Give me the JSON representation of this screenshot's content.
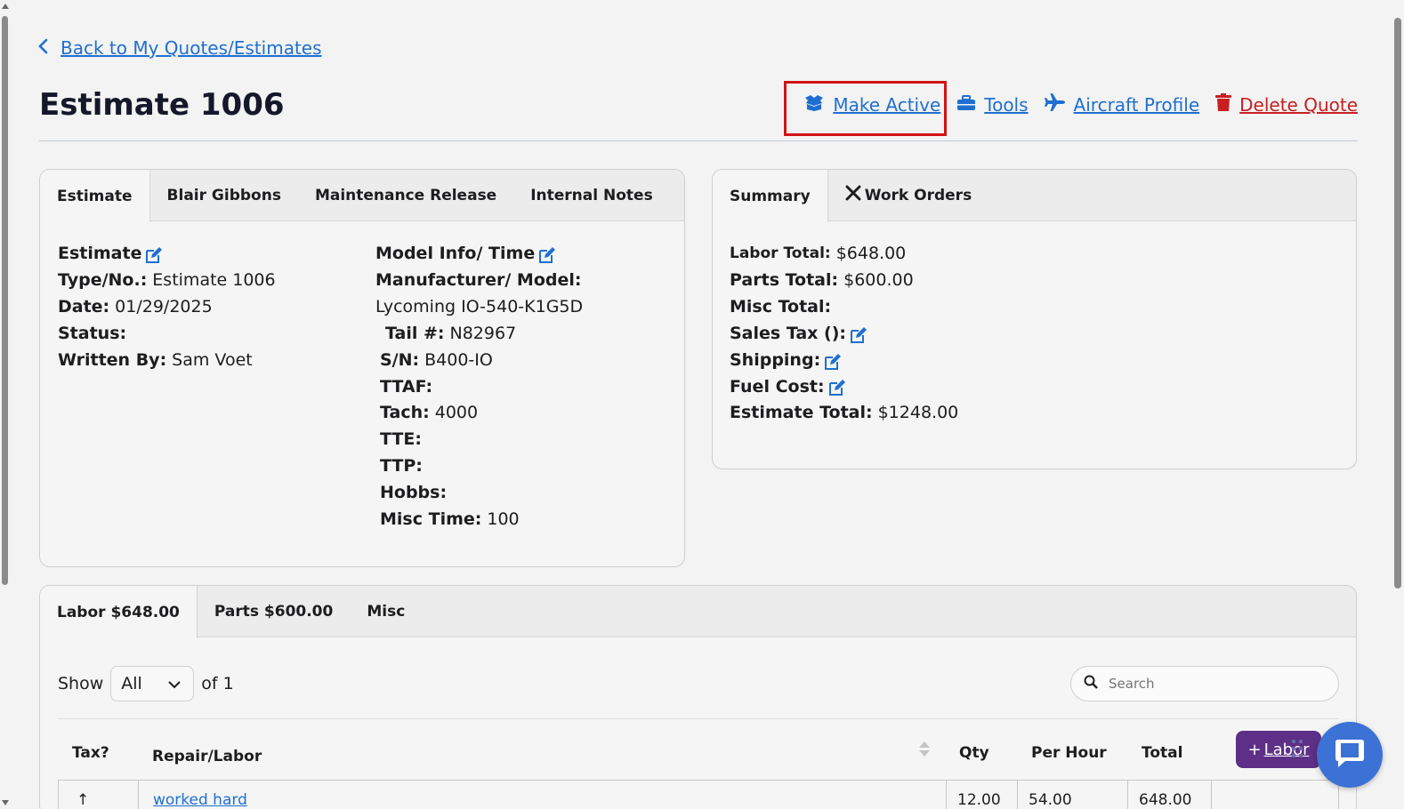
{
  "back_link": "Back to My Quotes/Estimates",
  "page_title": "Estimate 1006",
  "actions": {
    "make_active": "Make Active",
    "tools": "Tools",
    "aircraft_profile": "Aircraft Profile",
    "delete_quote": "Delete Quote"
  },
  "info_panel": {
    "tabs": [
      "Estimate",
      "Blair Gibbons",
      "Maintenance Release",
      "Internal Notes"
    ],
    "estimate": {
      "heading": "Estimate",
      "type_label": "Type/No.:",
      "type_value": "Estimate 1006",
      "date_label": "Date:",
      "date_value": "01/29/2025",
      "status_label": "Status:",
      "written_label": "Written By:",
      "written_value": "Sam Voet"
    },
    "model": {
      "heading": "Model Info/ Time",
      "manufacturer_label": "Manufacturer/ Model:",
      "manufacturer_value": "Lycoming IO-540-K1G5D",
      "tail_label": "Tail #:",
      "tail_value": "N82967",
      "sn_label": "S/N:",
      "sn_value": "B400-IO",
      "ttaf_label": "TTAF:",
      "tach_label": "Tach:",
      "tach_value": "4000",
      "tte_label": "TTE:",
      "ttp_label": "TTP:",
      "hobbs_label": "Hobbs:",
      "misc_label": "Misc Time:",
      "misc_value": "100"
    }
  },
  "summary_panel": {
    "tabs": [
      "Summary",
      "Work Orders"
    ],
    "labor_label": "Labor Total:",
    "labor_value": "$648.00",
    "parts_label": "Parts Total:",
    "parts_value": "$600.00",
    "misc_label": "Misc Total:",
    "sales_tax_label": "Sales Tax ():",
    "shipping_label": "Shipping:",
    "fuel_label": "Fuel Cost:",
    "estimate_total_label": "Estimate Total:",
    "estimate_total_value": "$1248.00"
  },
  "items_panel": {
    "tabs": [
      "Labor $648.00",
      "Parts $600.00",
      "Misc"
    ],
    "show_label": "Show",
    "show_value": "All",
    "of_label": "of 1",
    "search_placeholder": "Search",
    "columns": [
      "Tax?",
      "Repair/Labor",
      "Qty",
      "Per Hour",
      "Total"
    ],
    "rows": [
      {
        "tax": "↑",
        "labor": "worked hard",
        "qty": "12.00",
        "per_hour": "54.00",
        "total": "648.00"
      }
    ],
    "add_labor": "Labor"
  },
  "colors": {
    "link": "#1f6fd1",
    "danger": "#c82020",
    "highlight": "#d01414",
    "add_button": "#5d2f86",
    "chat": "#3c71d6"
  }
}
